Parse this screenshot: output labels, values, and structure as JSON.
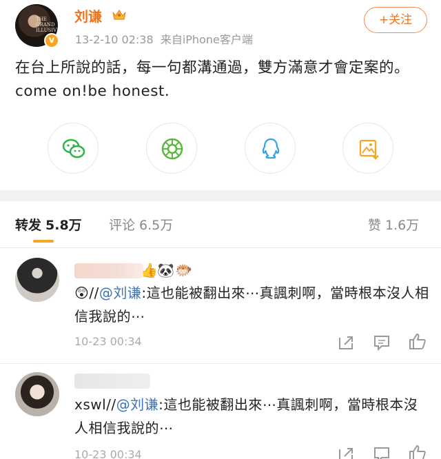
{
  "post": {
    "author": "刘谦",
    "meta": "13-2-10 02:38  来自iPhone客户端",
    "follow_label": "+关注",
    "text": "在台上所說的話，每一句都溝通過，雙方滿意才會定案的。come on!be honest.",
    "avatar_poster_text": "THE\nGRAND\nILLUSIVE"
  },
  "share": [
    {
      "name": "wechat",
      "color": "#2fb34a"
    },
    {
      "name": "moments",
      "color": "#59b93b"
    },
    {
      "name": "qq",
      "color": "#3aa3e3"
    },
    {
      "name": "save-image",
      "color": "#f5a623"
    }
  ],
  "tabs": {
    "repost_label": "转发",
    "repost_count": "5.8万",
    "comment_label": "评论",
    "comment_count": "6.5万",
    "like_label": "赞",
    "like_count": "1.6万"
  },
  "comments": [
    {
      "emoji_prefix": "😲",
      "prefix": "//",
      "mention": "@刘谦",
      "body": ":這也能被翻出來⋯真諷刺啊，當時根本沒人相信我說的⋯",
      "time": "10-23 00:34"
    },
    {
      "prefix": "xswl//",
      "mention": "@刘谦",
      "body": ":這也能被翻出來⋯真諷刺啊，當時根本沒人相信我說的⋯",
      "time": "10-23 00:34"
    }
  ],
  "colors": {
    "accent": "#f0731a",
    "mention": "#3e72b8",
    "tab_indicator": "#f5a623"
  }
}
